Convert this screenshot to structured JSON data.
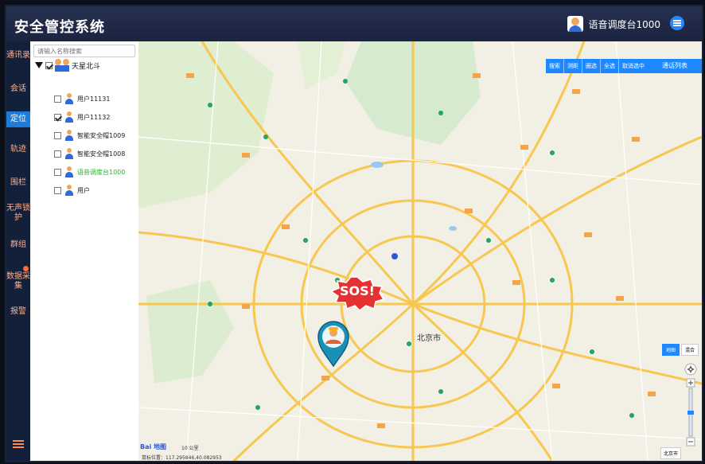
{
  "header": {
    "title": "安全管控系统",
    "user_label": "语音调度台1000"
  },
  "nav": {
    "items": [
      "通讯录",
      "会话",
      "定位",
      "轨迹",
      "围栏",
      "无声锁护",
      "群组",
      "数据采集",
      "报警"
    ],
    "active_index": 2,
    "badge_index": 7
  },
  "tree": {
    "search_placeholder": "请输入名称搜索",
    "root_label": "天星北斗",
    "items": [
      {
        "label": "用户11131",
        "checked": false,
        "online": false
      },
      {
        "label": "用户11132",
        "checked": true,
        "online": false
      },
      {
        "label": "智能安全帽1009",
        "checked": false,
        "online": false
      },
      {
        "label": "智能安全帽1008",
        "checked": false,
        "online": false
      },
      {
        "label": "语音调度台1000",
        "checked": false,
        "online": true
      },
      {
        "label": "用户",
        "checked": false,
        "online": false
      }
    ]
  },
  "map_toolbar": {
    "buttons": [
      "搜索",
      "测距",
      "圈选",
      "全选",
      "取消选中"
    ],
    "call_list": "通话列表"
  },
  "map": {
    "city_label": "北京市",
    "sos_text": "SOS!",
    "scale_label": "10 公里",
    "coords": "鼠标位置：117.295846,40.082953",
    "brand": "Bai 地图",
    "map_types": [
      "地图",
      "混合"
    ],
    "active_map_type": 0,
    "city_select": "北京市"
  },
  "colors": {
    "accent": "#1e88ff",
    "sos": "#e53131",
    "online": "#2fb12f",
    "nav_text": "#ffb08a"
  }
}
